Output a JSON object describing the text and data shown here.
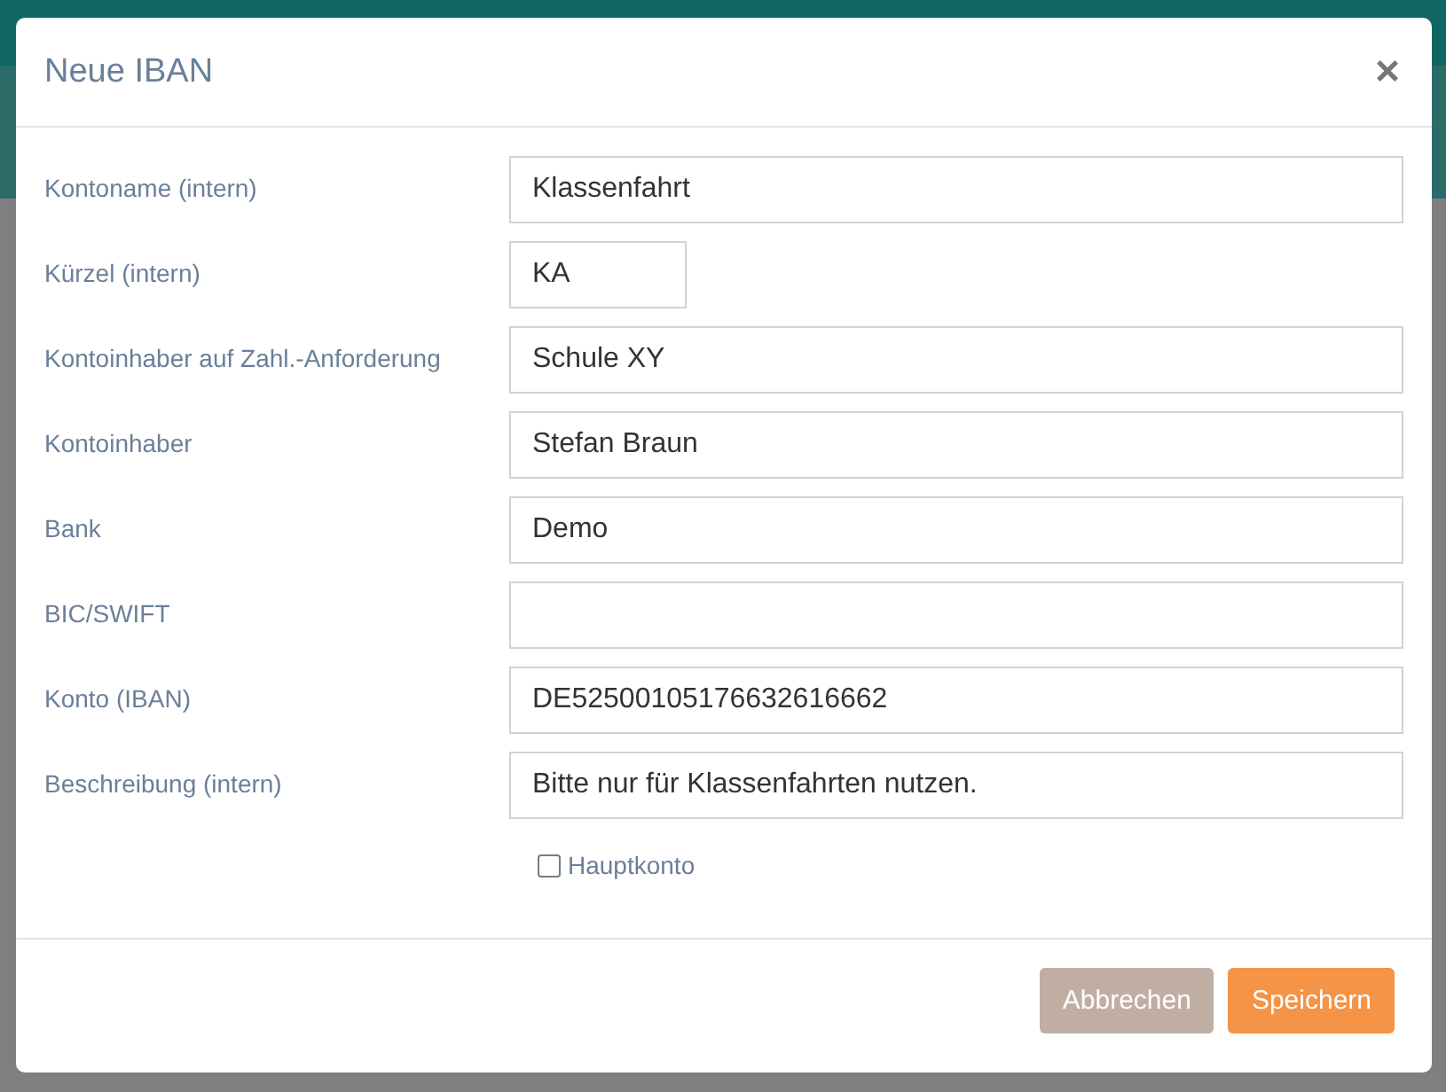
{
  "dialog": {
    "title": "Neue IBAN",
    "close": "×"
  },
  "fields": [
    {
      "label": "Kontoname (intern)",
      "value": "Klassenfahrt",
      "kind": "wide"
    },
    {
      "label": "Kürzel (intern)",
      "value": "KA",
      "kind": "short"
    },
    {
      "label": "Kontoinhaber auf Zahl.-Anforderung",
      "value": "Schule XY",
      "kind": "wide"
    },
    {
      "label": "Kontoinhaber",
      "value": "Stefan Braun",
      "kind": "wide"
    },
    {
      "label": "Bank",
      "value": "Demo",
      "kind": "wide"
    },
    {
      "label": "BIC/SWIFT",
      "kind": "wide"
    },
    {
      "label": "Konto (IBAN)",
      "value": "DE52500105176632616662",
      "kind": "wide"
    },
    {
      "label": "Beschreibung (intern)",
      "value": "Bitte nur für Klassenfahrten nutzen.",
      "kind": "wide"
    }
  ],
  "checkbox": {
    "label": "Hauptkonto",
    "checked": false
  },
  "buttons": [
    {
      "label": "Abbrechen",
      "kind": "secondary"
    },
    {
      "label": "Speichern",
      "kind": "primary"
    }
  ]
}
